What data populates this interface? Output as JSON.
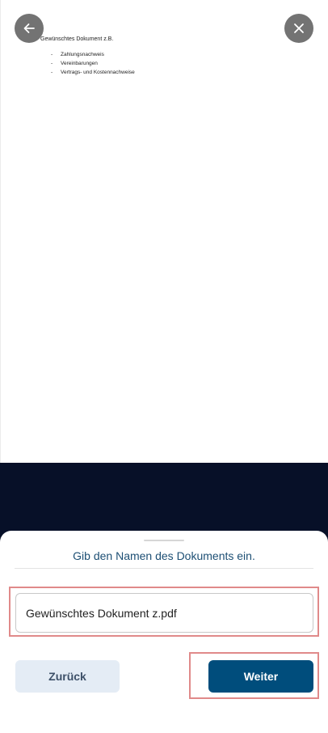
{
  "document_preview": {
    "heading": "Gewünschtes Dokument z.B.",
    "items": [
      {
        "dash": "-",
        "label": "Zahlungsnachweis"
      },
      {
        "dash": "-",
        "label": "Vereinbarungen"
      },
      {
        "dash": "-",
        "label": "Vertrags- und Kostennachweise"
      }
    ]
  },
  "controls": {
    "back_icon": "arrow-left-icon",
    "close_icon": "close-icon"
  },
  "sheet": {
    "title": "Gib den Namen des Dokuments ein.",
    "input_value": "Gewünschtes Dokument z.pdf",
    "back_label": "Zurück",
    "next_label": "Weiter"
  },
  "colors": {
    "primary": "#004d7c",
    "secondary_bg": "#e4ecf5",
    "title_text": "#1d4f74",
    "dark_band": "#071028",
    "highlight": "#e08a8a",
    "circle_button": "#737373"
  }
}
